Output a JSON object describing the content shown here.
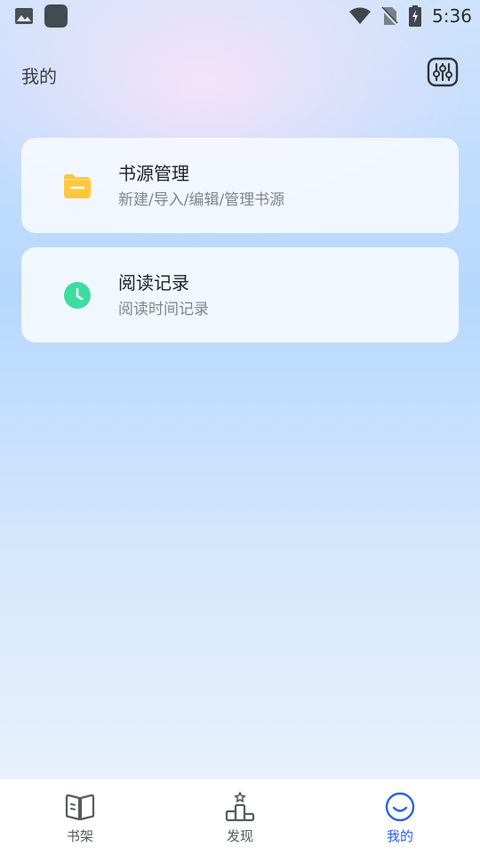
{
  "status_bar": {
    "time": "5:36",
    "icons": [
      "image-icon",
      "app-icon",
      "wifi-icon",
      "no-sim-icon",
      "battery-charging-icon"
    ]
  },
  "header": {
    "title": "我的",
    "settings_icon": "sliders-icon"
  },
  "cards": [
    {
      "title": "书源管理",
      "subtitle": "新建/导入/编辑/管理书源",
      "icon": "folder-icon",
      "icon_color": "#ffc83d"
    },
    {
      "title": "阅读记录",
      "subtitle": "阅读时间记录",
      "icon": "clock-icon",
      "icon_color": "#3ddca0"
    }
  ],
  "bottom_nav": {
    "items": [
      {
        "label": "书架",
        "icon": "book-icon",
        "active": false
      },
      {
        "label": "发现",
        "icon": "podium-icon",
        "active": false
      },
      {
        "label": "我的",
        "icon": "smile-icon",
        "active": true
      }
    ],
    "active_color": "#2a63e6"
  }
}
